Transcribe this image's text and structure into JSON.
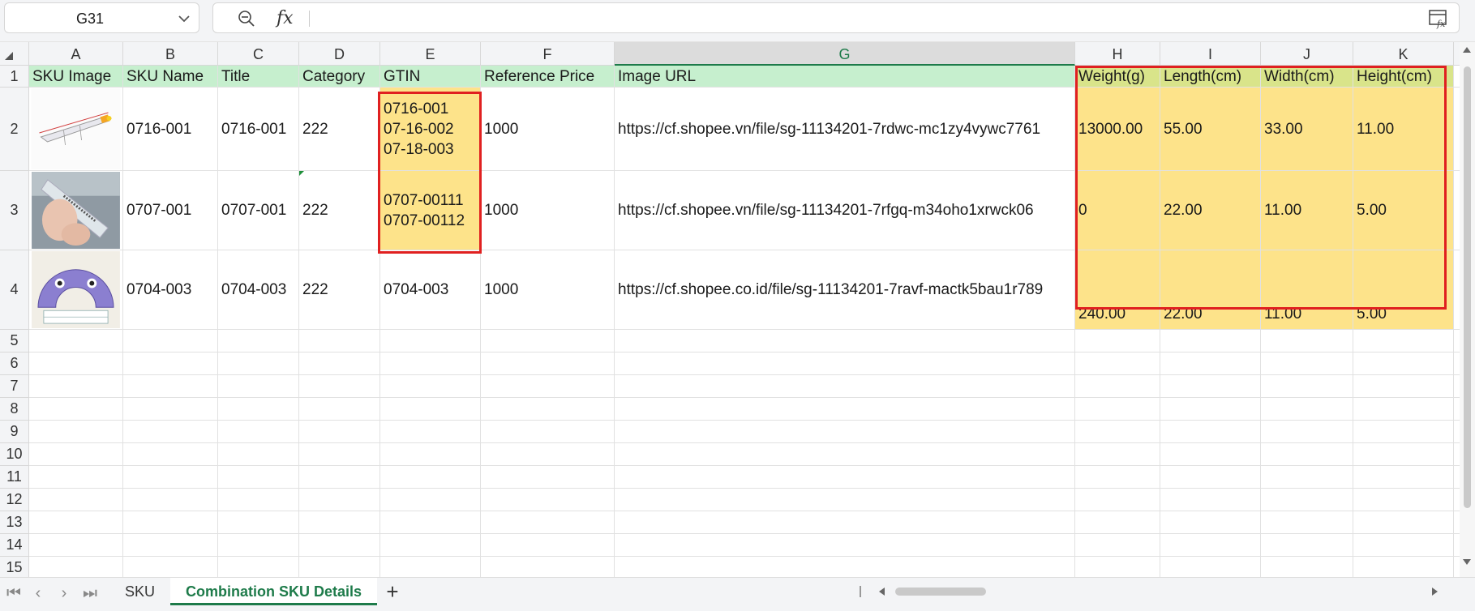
{
  "formula_bar": {
    "cell_ref": "G31",
    "fx_label": "fx",
    "formula": ""
  },
  "columns": [
    "A",
    "B",
    "C",
    "D",
    "E",
    "F",
    "G",
    "H",
    "I",
    "J",
    "K"
  ],
  "active_column": "G",
  "row_numbers": [
    "1",
    "2",
    "3",
    "4",
    "5",
    "6",
    "7",
    "8",
    "9",
    "10",
    "11",
    "12",
    "13",
    "14",
    "15"
  ],
  "headers": [
    "SKU Image",
    "SKU Name",
    "Title",
    "Category",
    "GTIN",
    "Reference Price",
    "Image URL",
    "Weight(g)",
    "Length(cm)",
    "Width(cm)",
    "Height(cm)"
  ],
  "rows": [
    {
      "image": "pen-product-photo",
      "sku_name": "0716-001",
      "title": "0716-001",
      "category": "222",
      "gtin": "0716-001\n07-16-002\n07-18-003",
      "reference_price": "1000",
      "image_url": "https://cf.shopee.vn/file/sg-11134201-7rdwc-mc1zy4vywc7761",
      "weight": "13000.00",
      "length": "55.00",
      "width": "33.00",
      "height": "11.00"
    },
    {
      "image": "hand-holding-brush-photo",
      "sku_name": "0707-001",
      "title": "0707-001",
      "category": "222",
      "gtin": "0707-00111\n0707-00112",
      "reference_price": "1000",
      "image_url": "https://cf.shopee.vn/file/sg-11134201-7rfgq-m34oho1xrwck06",
      "weight": "0",
      "length": "22.00",
      "width": "11.00",
      "height": "5.00"
    },
    {
      "image": "purple-cartoon-product-photo",
      "sku_name": "0704-003",
      "title": "0704-003",
      "category": "222",
      "gtin": "0704-003",
      "reference_price": "1000",
      "image_url": "https://cf.shopee.co.id/file/sg-11134201-7ravf-mactk5bau1r789",
      "weight": "240.00",
      "length": "22.00",
      "width": "11.00",
      "height": "5.00"
    }
  ],
  "sheet_tabs": [
    {
      "label": "SKU",
      "active": false
    },
    {
      "label": "Combination SKU Details",
      "active": true
    }
  ],
  "colors": {
    "header_fill": "#c6efce",
    "highlight_fill": "#fde38a",
    "annotation_border": "#e02020",
    "accent": "#1e7b4a"
  }
}
